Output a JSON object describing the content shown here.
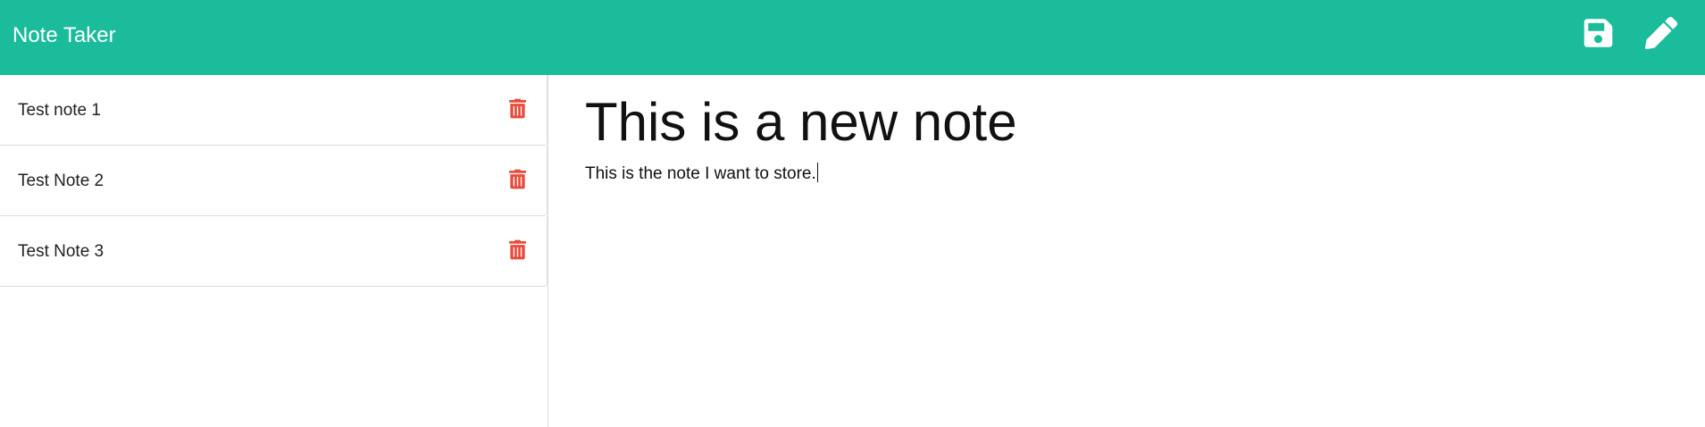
{
  "app": {
    "title": "Note Taker"
  },
  "toolbar": {
    "save_icon": "save-icon",
    "edit_icon": "pencil-icon"
  },
  "notes": [
    {
      "title": "Test note 1"
    },
    {
      "title": "Test Note 2"
    },
    {
      "title": "Test Note 3"
    }
  ],
  "active_note": {
    "title": "This is a new note",
    "text": "This is the note I want to store."
  },
  "colors": {
    "navbar": "#1abc9c",
    "delete": "#e74c3c",
    "text": "#111111"
  }
}
